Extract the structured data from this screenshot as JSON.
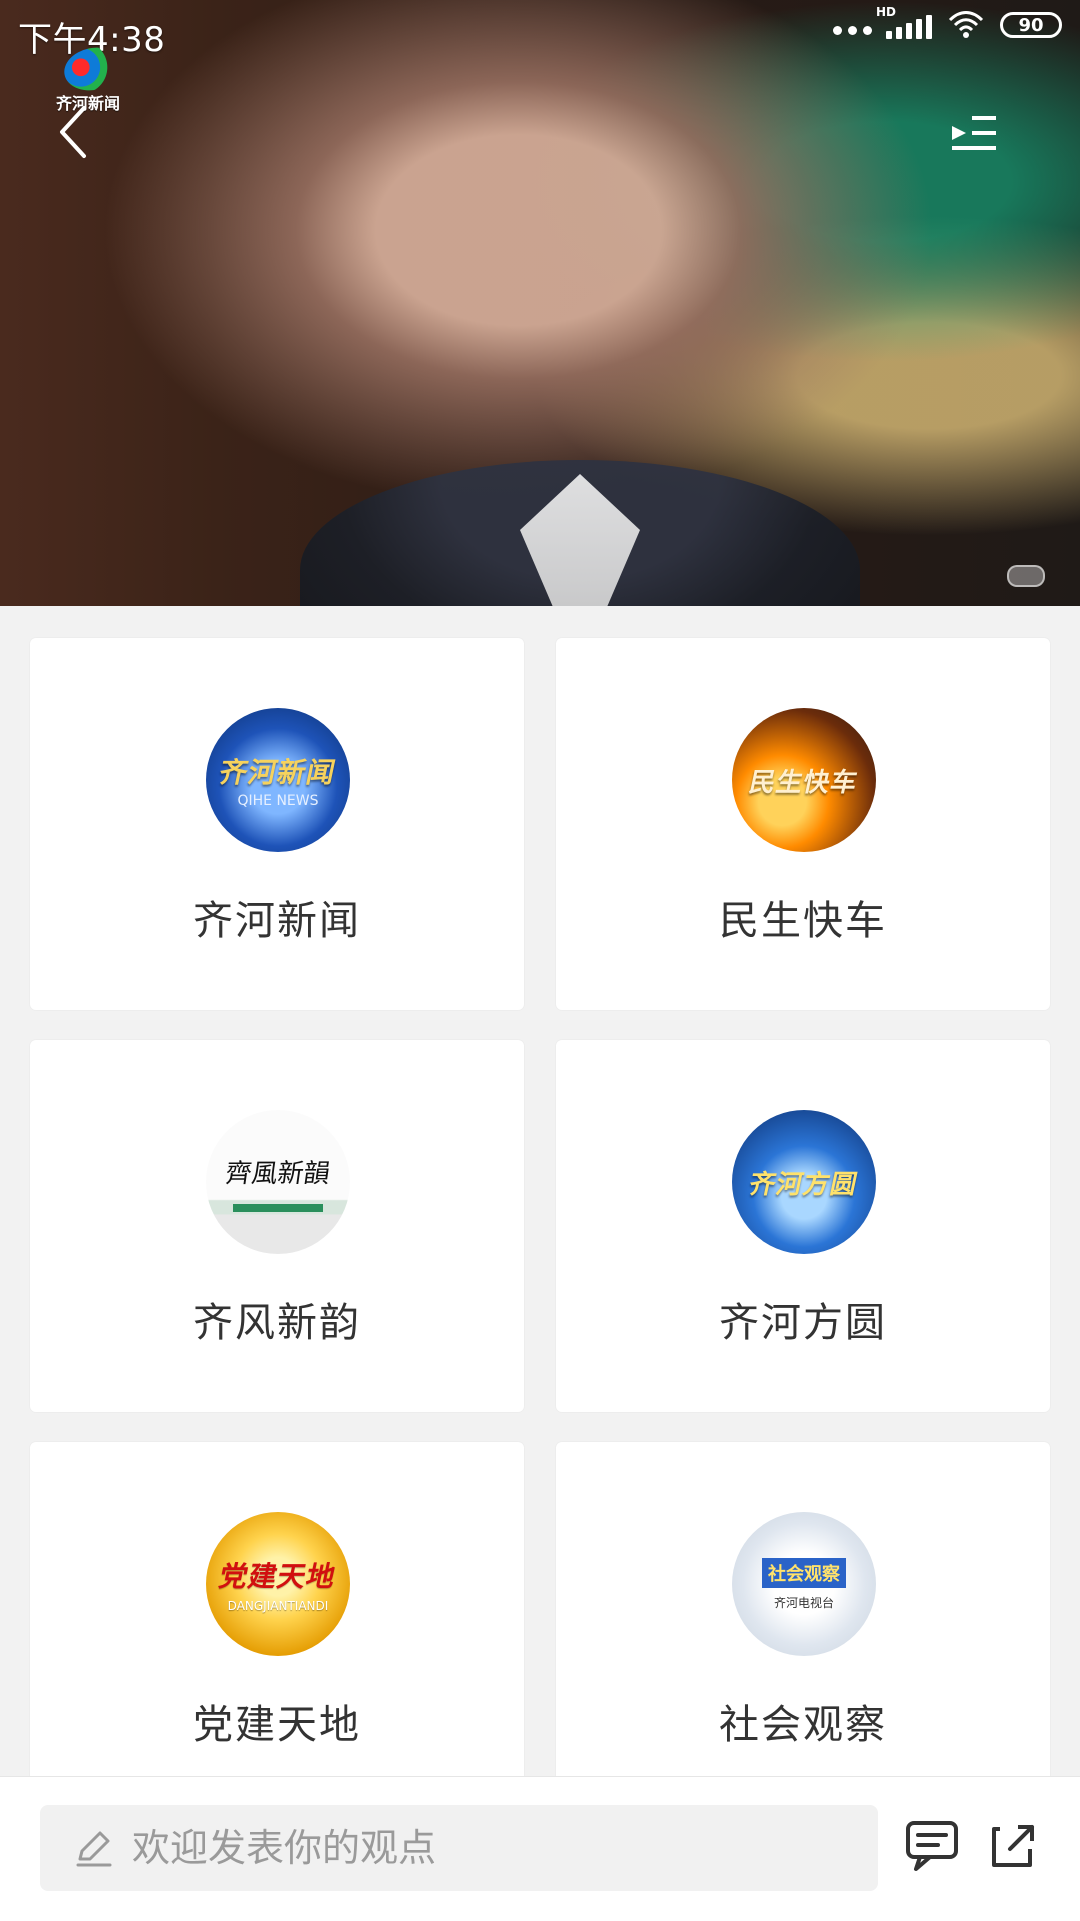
{
  "status_bar": {
    "time": "下午4:38",
    "network_label": "HD",
    "battery": "90"
  },
  "header": {
    "channel_logo_text": "齐河新闻",
    "back_icon": "chevron-left-icon",
    "playlist_icon": "playlist-icon"
  },
  "programs": [
    {
      "label": "齐河新闻",
      "thumb_text": "齐河新闻",
      "thumb_sub": "QIHE NEWS"
    },
    {
      "label": "民生快车",
      "thumb_text": "民生快车"
    },
    {
      "label": "齐风新韵",
      "thumb_text": "齊風新韻"
    },
    {
      "label": "齐河方圆",
      "thumb_text": "齐河方圆"
    },
    {
      "label": "党建天地",
      "thumb_text": "党建天地",
      "thumb_sub": "DANGJIANTIANDI"
    },
    {
      "label": "社会观察",
      "thumb_text": "社会观察",
      "thumb_sub": "齐河电视台"
    }
  ],
  "bottom_bar": {
    "comment_placeholder": "欢迎发表你的观点",
    "comment_icon": "chat-bubble-icon",
    "share_icon": "share-icon"
  },
  "colors": {
    "background": "#f2f2f2",
    "card": "#ffffff",
    "text": "#333333",
    "placeholder": "#9a9a9a"
  }
}
